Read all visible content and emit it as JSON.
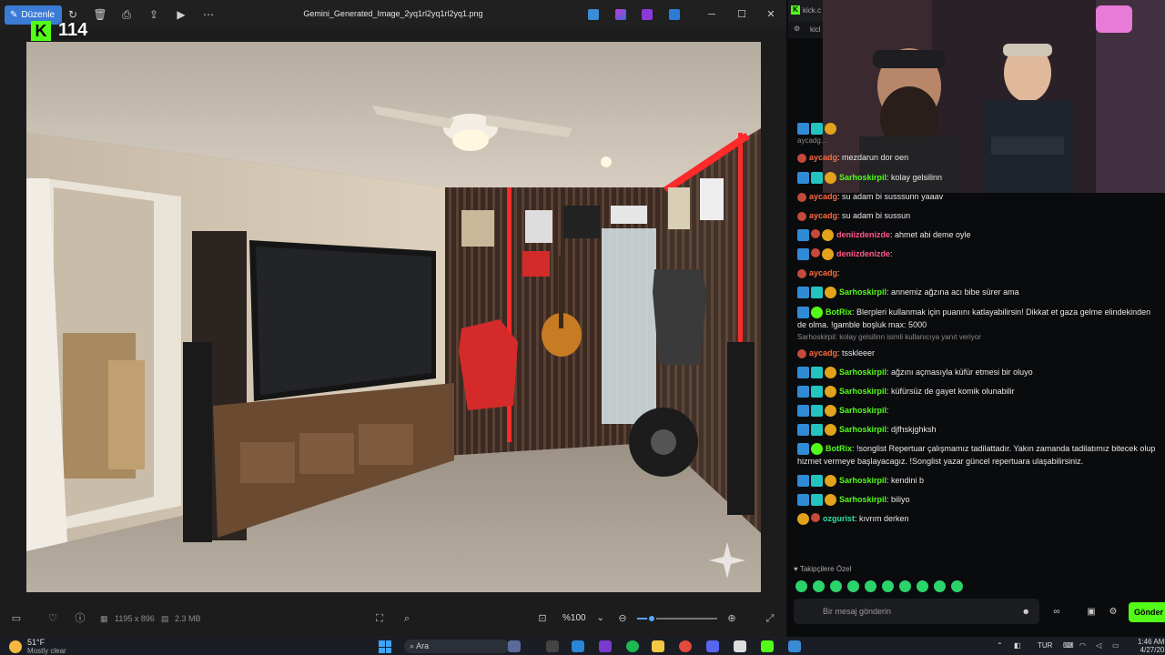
{
  "viewer": {
    "edit_label": "Düzenle",
    "file_title": "Gemini_Generated_Image_2yq1rl2yq1rl2yq1.png",
    "kick_viewers": "114",
    "status": {
      "dimensions": "1195 x 896",
      "file_size": "2.3 MB",
      "zoom": "%100",
      "zoom_fraction": 0.18
    }
  },
  "taskbar": {
    "temperature": "51°F",
    "condition": "Mostly clear",
    "search_label": "Ara",
    "language": "TUR",
    "time": "1:46 AM",
    "date": "4/27/20"
  },
  "kick": {
    "tab_title": "kick.c",
    "url_fragment": "kicl",
    "chat": [
      {
        "type": "msg",
        "badges": [
          "blue",
          "teal",
          "gold"
        ],
        "user": "",
        "user_color": "u-green",
        "text": "",
        "top": 0
      },
      {
        "type": "reply",
        "text": "aycadg...",
        "top": 0
      },
      {
        "type": "msg",
        "badges": [
          "red"
        ],
        "user": "aycadg",
        "user_color": "u-orange",
        "text": ": mezdarun dor oen",
        "top": 0
      },
      {
        "type": "msg",
        "badges": [
          "blue",
          "teal",
          "gold"
        ],
        "user": "Sarhoskirpil",
        "user_color": "u-green",
        "text": ": kolay gelsilinn",
        "top": 0
      },
      {
        "type": "msg",
        "badges": [
          "red"
        ],
        "user": "aycadg",
        "user_color": "u-orange",
        "text": ": su adam bi susssunn yaaav",
        "top": 0
      },
      {
        "type": "msg",
        "badges": [
          "red"
        ],
        "user": "aycadg",
        "user_color": "u-orange",
        "text": ": su adam bi sussun",
        "top": 0
      },
      {
        "type": "msg",
        "badges": [
          "blue",
          "red",
          "gold"
        ],
        "user": "deniizdenizde",
        "user_color": "u-pink",
        "text": ": ahmet abi deme oyle",
        "top": 0
      },
      {
        "type": "msg",
        "badges": [
          "blue",
          "red",
          "gold"
        ],
        "user": "deniizdenizde",
        "user_color": "u-pink",
        "text": ":",
        "top": 0
      },
      {
        "type": "msg",
        "badges": [
          "red"
        ],
        "user": "aycadg",
        "user_color": "u-orange",
        "text": ":",
        "top": 0
      },
      {
        "type": "msg",
        "badges": [
          "blue",
          "teal",
          "gold"
        ],
        "user": "Sarhoskirpil",
        "user_color": "u-green",
        "text": ": annemiz ağzına acı bibe sürer ama",
        "top": 0
      },
      {
        "type": "msg",
        "badges": [
          "blue",
          "bot"
        ],
        "user": "BotRix",
        "user_color": "u-green",
        "text": ": Blerpleri kullanmak için puanını katlayabilirsin! Dikkat et gaza gelme elindekinden",
        "top": 0
      },
      {
        "type": "cont",
        "text": "de olma. !gamble boşluk max: 5000",
        "top": 0
      },
      {
        "type": "reply",
        "text": "Sarhoskirpil: kolay gelsilinn isimli kullanıcıya yanıt veriyor",
        "top": 0
      },
      {
        "type": "msg",
        "badges": [
          "red"
        ],
        "user": "aycadg",
        "user_color": "u-orange",
        "text": ": tsskleeer",
        "top": 0
      },
      {
        "type": "msg",
        "badges": [
          "blue",
          "teal",
          "gold"
        ],
        "user": "Sarhoskirpil",
        "user_color": "u-green",
        "text": ": ağzını açmasıyla küfür etmesi bir oluyo",
        "top": 0
      },
      {
        "type": "msg",
        "badges": [
          "blue",
          "teal",
          "gold"
        ],
        "user": "Sarhoskirpil",
        "user_color": "u-green",
        "text": ": küfürsüz de gayet komik olunabilir",
        "top": 0
      },
      {
        "type": "msg",
        "badges": [
          "blue",
          "teal",
          "gold"
        ],
        "user": "Sarhoskirpil",
        "user_color": "u-green",
        "text": ":",
        "top": 0
      },
      {
        "type": "msg",
        "badges": [
          "blue",
          "teal",
          "gold"
        ],
        "user": "Sarhoskirpil",
        "user_color": "u-green",
        "text": ": djfhskjghksh",
        "top": 0
      },
      {
        "type": "msg",
        "badges": [
          "blue",
          "bot"
        ],
        "user": "BotRix",
        "user_color": "u-green",
        "text": ": !songlist Repertuar çalışmamız tadilattadır. Yakın zamanda tadilatımız bitecek olup",
        "top": 0
      },
      {
        "type": "cont",
        "text": "hizmet vermeye başlayacagız. !Songlist yazar güncel repertuara ulaşabilirsiniz.",
        "top": 0
      },
      {
        "type": "msg",
        "badges": [
          "blue",
          "teal",
          "gold"
        ],
        "user": "Sarhoskirpil",
        "user_color": "u-green",
        "text": ": kendini b",
        "top": 0
      },
      {
        "type": "msg",
        "badges": [
          "blue",
          "teal",
          "gold"
        ],
        "user": "Sarhoskirpil",
        "user_color": "u-green",
        "text": ": biliyo",
        "top": 0
      },
      {
        "type": "msg",
        "badges": [
          "gold",
          "red"
        ],
        "user": "ozgurist",
        "user_color": "u-teal",
        "text": ": kıvrım derken",
        "top": 0
      }
    ],
    "followers_label": "Takipçilere Özel",
    "input_placeholder": "Bir mesaj gönderin",
    "send_label": "Gönder"
  }
}
